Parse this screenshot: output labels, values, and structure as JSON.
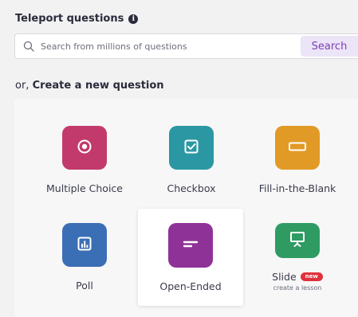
{
  "teleport": {
    "title": "Teleport questions",
    "info_icon": "i",
    "search_placeholder": "Search from millions of questions",
    "search_button": "Search"
  },
  "create": {
    "prefix": "or, ",
    "title": "Create a new question"
  },
  "question_types": [
    {
      "label": "Multiple Choice",
      "icon": "radio-icon",
      "color": "#c23a6b"
    },
    {
      "label": "Checkbox",
      "icon": "checkbox-icon",
      "color": "#2b97a3"
    },
    {
      "label": "Fill-in-the-Blank",
      "icon": "blank-box-icon",
      "color": "#e29a26"
    },
    {
      "label": "Poll",
      "icon": "bar-chart-icon",
      "color": "#3b6fb5"
    },
    {
      "label": "Open-Ended",
      "icon": "text-lines-icon",
      "color": "#8f3297"
    },
    {
      "label": "Slide",
      "icon": "presentation-icon",
      "color": "#2f9b63",
      "badge": "new",
      "sublabel": "create a lesson"
    }
  ],
  "colors": {
    "accent": "#7b3fb8",
    "search_button_bg": "#ece4f7",
    "badge": "#e0323c"
  }
}
